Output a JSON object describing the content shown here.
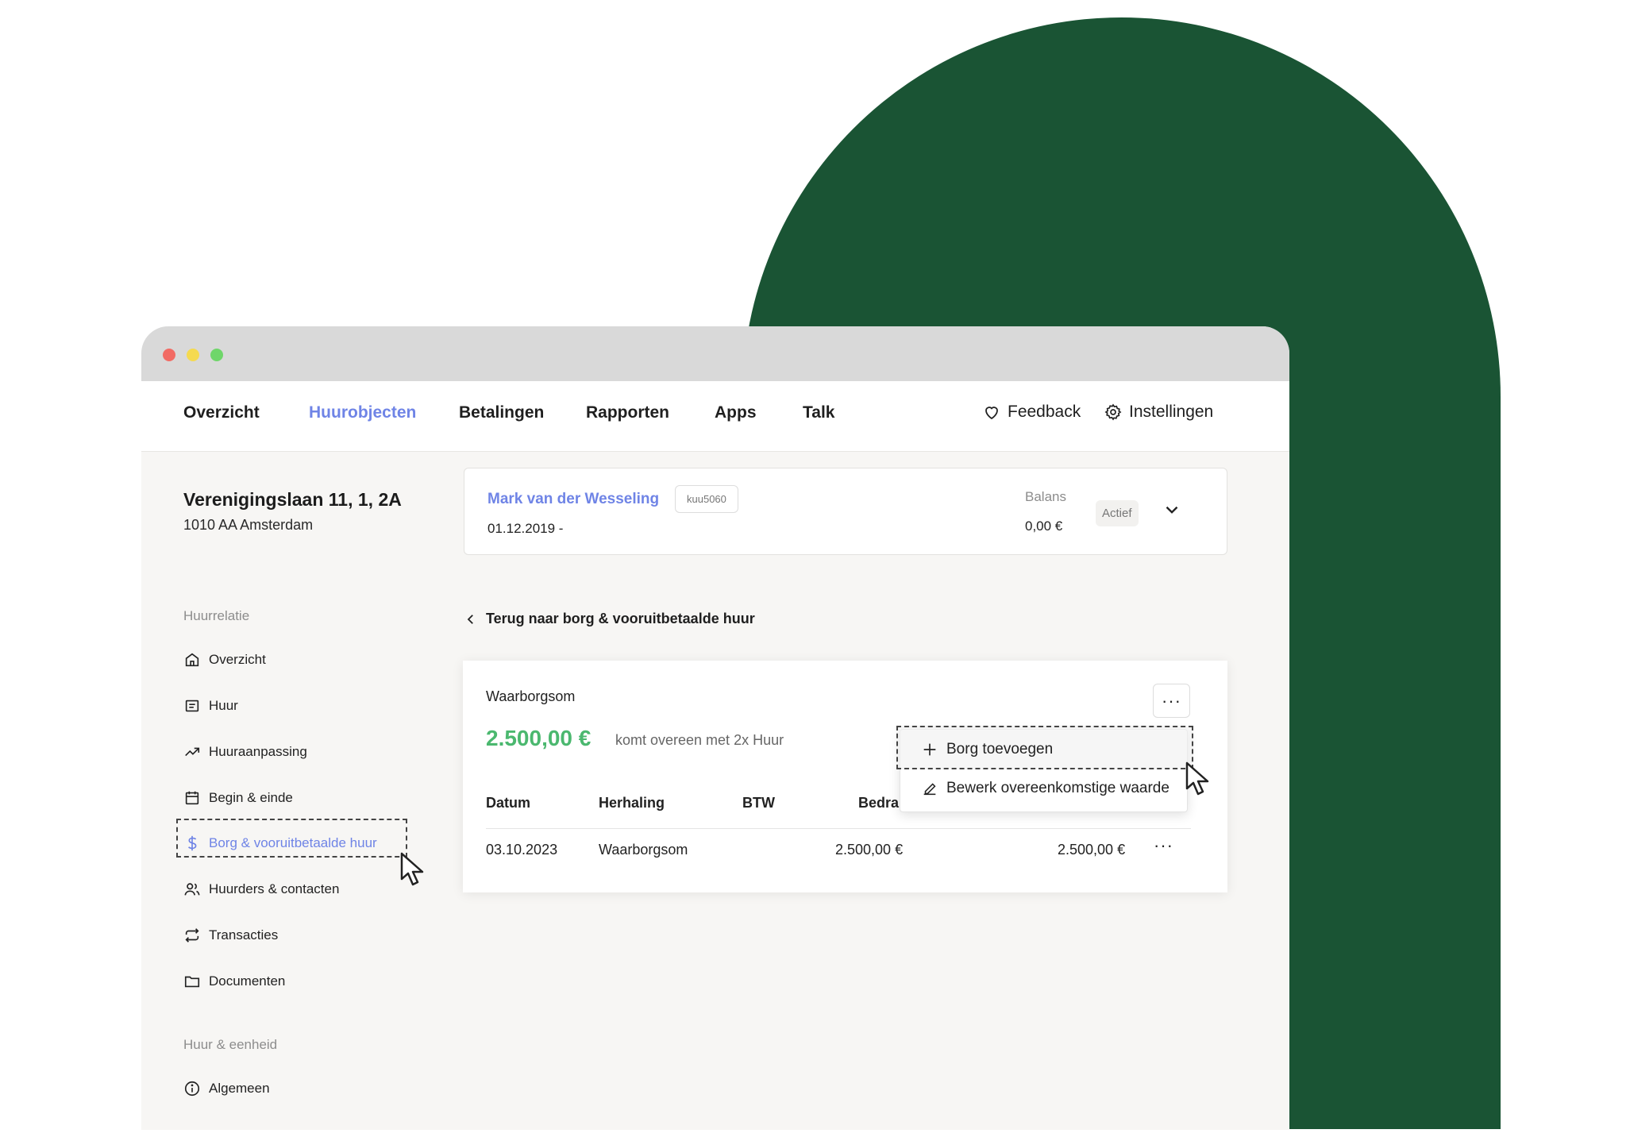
{
  "colors": {
    "accent": "#6f84e6",
    "amount_green": "#4bb86f",
    "background_arch": "#1a5434"
  },
  "nav": {
    "items": [
      "Overzicht",
      "Huurobjecten",
      "Betalingen",
      "Rapporten",
      "Apps",
      "Talk"
    ],
    "active": "Huurobjecten",
    "feedback": "Feedback",
    "settings": "Instellingen"
  },
  "property": {
    "address": "Verenigingslaan 11, 1, 2A",
    "city": "1010 AA Amsterdam"
  },
  "sidebar": {
    "section1": "Huurrelatie",
    "items": [
      {
        "label": "Overzicht",
        "icon": "home-icon"
      },
      {
        "label": "Huur",
        "icon": "receipt-icon"
      },
      {
        "label": "Huuraanpassing",
        "icon": "trend-up-icon"
      },
      {
        "label": "Begin & einde",
        "icon": "calendar-icon"
      },
      {
        "label": "Borg & vooruitbetaalde huur",
        "icon": "dollar-icon"
      },
      {
        "label": "Huurders & contacten",
        "icon": "users-icon"
      },
      {
        "label": "Transacties",
        "icon": "repeat-icon"
      },
      {
        "label": "Documenten",
        "icon": "folder-icon"
      }
    ],
    "active": "Borg & vooruitbetaalde huur",
    "section2": "Huur & eenheid",
    "items2": [
      {
        "label": "Algemeen",
        "icon": "info-icon"
      }
    ]
  },
  "tenant": {
    "name": "Mark van der Wesseling",
    "code": "kuu5060",
    "date": "01.12.2019 -",
    "balance_label": "Balans",
    "balance_value": "0,00 €",
    "status": "Actief"
  },
  "back_link": "Terug naar borg & vooruitbetaalde huur",
  "deposit": {
    "title": "Waarborgsom",
    "amount": "2.500,00 €",
    "note": "komt overeen met 2x Huur",
    "more": "···",
    "headers": [
      "Datum",
      "Herhaling",
      "BTW",
      "Bedra"
    ],
    "row": {
      "date": "03.10.2023",
      "recurrence": "Waarborgsom",
      "amount": "2.500,00 €",
      "total": "2.500,00 €",
      "more": "···"
    }
  },
  "menu": {
    "items": [
      "Borg toevoegen",
      "Bewerk overeenkomstige waarde"
    ]
  }
}
